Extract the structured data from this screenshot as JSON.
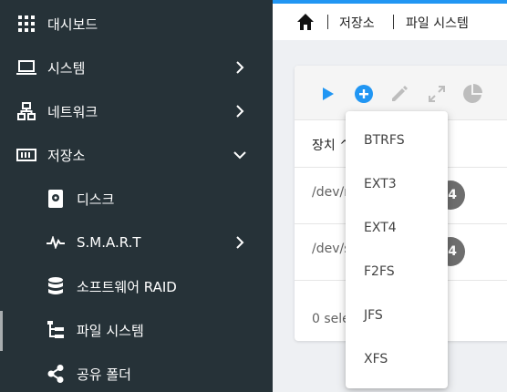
{
  "sidebar": {
    "items": [
      {
        "label": "대시보드",
        "icon": "dashboard-grid-icon"
      },
      {
        "label": "시스템",
        "icon": "laptop-icon"
      },
      {
        "label": "네트워크",
        "icon": "network-icon"
      },
      {
        "label": "저장소",
        "icon": "storage-icon"
      },
      {
        "label": "디스크",
        "icon": "disk-icon"
      },
      {
        "label": "S.M.A.R.T",
        "icon": "pulse-icon"
      },
      {
        "label": "소프트웨어 RAID",
        "icon": "database-icon"
      },
      {
        "label": "파일 시스템",
        "icon": "file-tree-icon"
      },
      {
        "label": "공유 폴더",
        "icon": "share-icon"
      }
    ]
  },
  "breadcrumb": {
    "home_icon": "home-icon",
    "items": [
      "저장소",
      "파일 시스템"
    ]
  },
  "toolbar": {
    "icons": [
      "play-icon",
      "add-circle-icon",
      "pencil-icon",
      "expand-icon",
      "pie-chart-icon"
    ],
    "accent": "#2196f3"
  },
  "table": {
    "header": "장치 ^",
    "rows": [
      {
        "device": "/dev/n",
        "badge": "4"
      },
      {
        "device": "/dev/s",
        "badge": "4"
      }
    ],
    "footer": "0 sele"
  },
  "dropdown": {
    "options": [
      "BTRFS",
      "EXT3",
      "EXT4",
      "F2FS",
      "JFS",
      "XFS"
    ]
  },
  "colors": {
    "sidebar_bg": "#263238",
    "accent": "#2196f3",
    "badge": "#6e6e6e"
  }
}
